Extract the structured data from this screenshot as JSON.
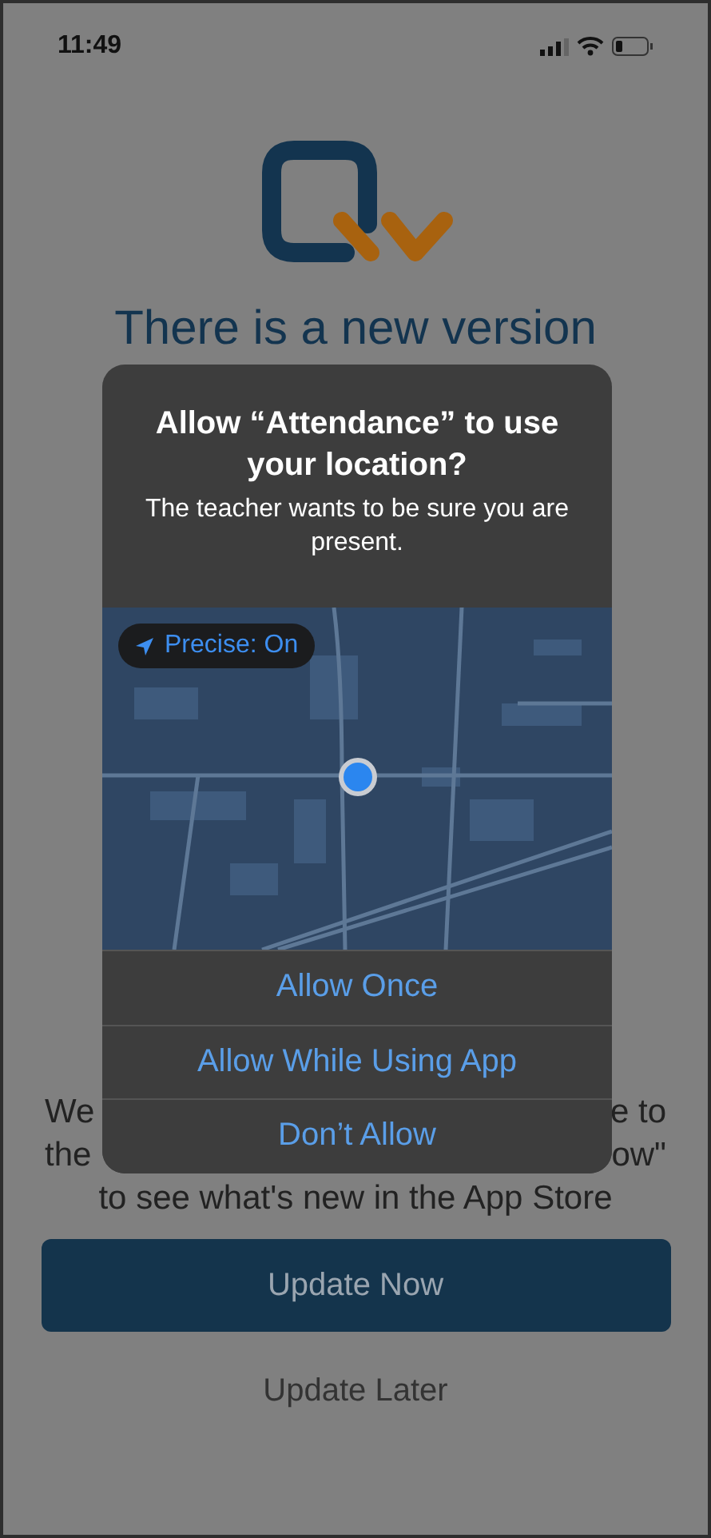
{
  "status_bar": {
    "time": "11:49"
  },
  "update_screen": {
    "title": "There is a new version",
    "message_fragments": [
      {
        "left": "We",
        "right": "e to"
      },
      {
        "left": "the",
        "right": "ow\""
      }
    ],
    "message_last_line": "to see what's new in the App Store",
    "primary_button": "Update Now",
    "secondary_button": "Update Later"
  },
  "alert": {
    "title": "Allow “Attendance” to use your location?",
    "message": "The teacher wants to be sure you are present.",
    "precise_toggle": {
      "label": "Precise: On"
    },
    "actions": [
      "Allow Once",
      "Allow While Using App",
      "Don’t Allow"
    ]
  }
}
